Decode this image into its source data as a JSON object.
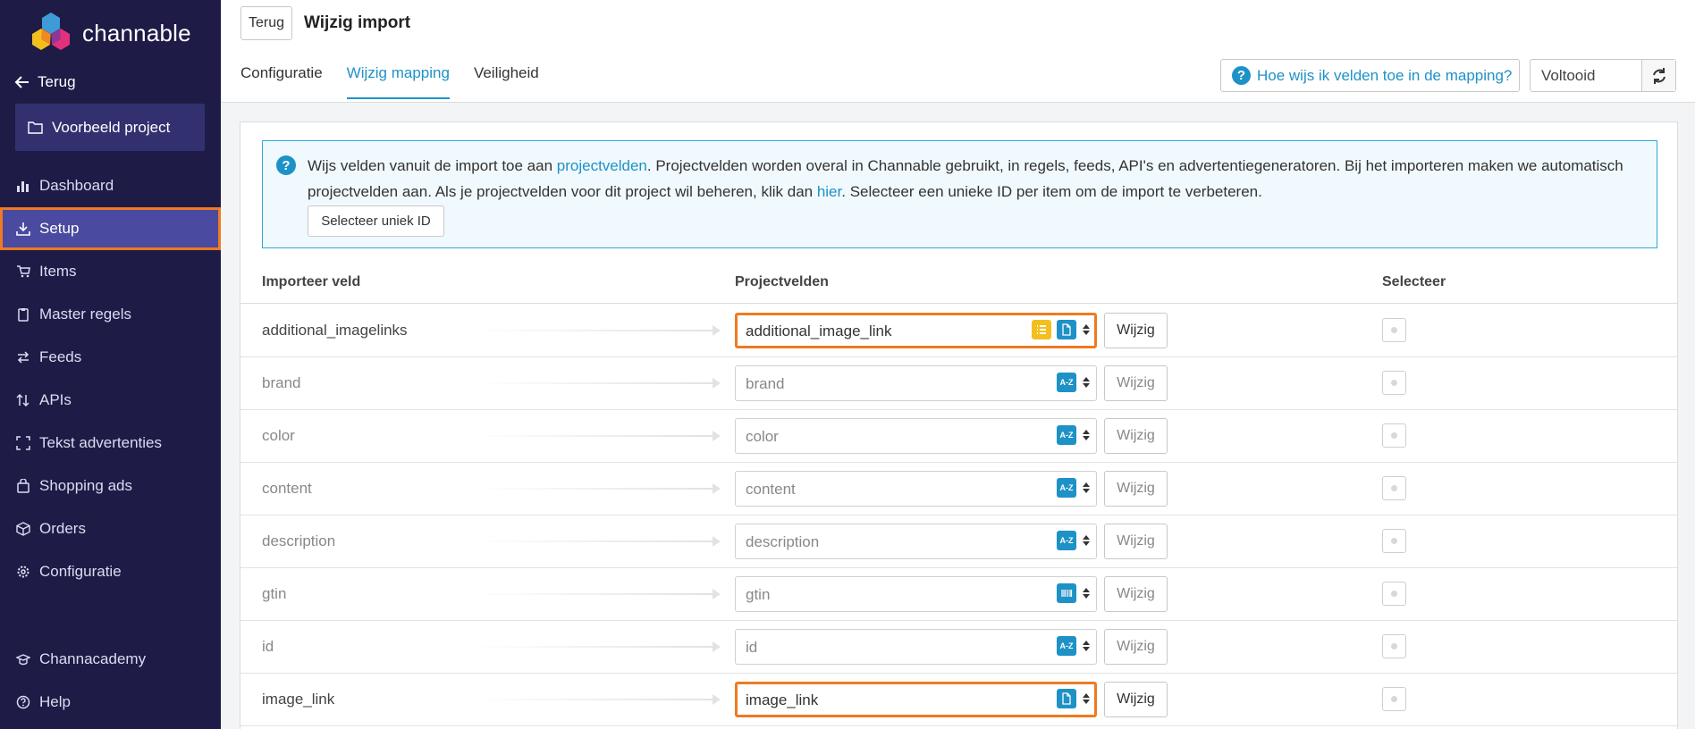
{
  "brand": {
    "name": "channable"
  },
  "sidebar": {
    "back_label": "Terug",
    "project_label": "Voorbeeld project",
    "items": [
      {
        "label": "Dashboard",
        "icon": "chart-bar-icon",
        "active": false
      },
      {
        "label": "Setup",
        "icon": "import-icon",
        "active": true
      },
      {
        "label": "Items",
        "icon": "cart-icon",
        "active": false
      },
      {
        "label": "Master regels",
        "icon": "clipboard-icon",
        "active": false
      },
      {
        "label": "Feeds",
        "icon": "arrows-icon",
        "active": false
      },
      {
        "label": "APIs",
        "icon": "sort-icon",
        "active": false
      },
      {
        "label": "Tekst advertenties",
        "icon": "expand-icon",
        "active": false
      },
      {
        "label": "Shopping ads",
        "icon": "bag-icon",
        "active": false
      },
      {
        "label": "Orders",
        "icon": "box-icon",
        "active": false
      },
      {
        "label": "Configuratie",
        "icon": "gear-icon",
        "active": false
      }
    ],
    "bottom_items": [
      {
        "label": "Channacademy",
        "icon": "graduation-cap-icon"
      },
      {
        "label": "Help",
        "icon": "question-circle-icon"
      }
    ]
  },
  "header": {
    "back_button": "Terug",
    "title": "Wijzig import",
    "tabs": [
      {
        "label": "Configuratie",
        "active": false
      },
      {
        "label": "Wijzig mapping",
        "active": true
      },
      {
        "label": "Veiligheid",
        "active": false
      }
    ],
    "help_button": "Hoe wijs ik velden toe in de mapping?",
    "status": "Voltooid"
  },
  "info": {
    "text_1": "Wijs velden vanuit de import toe aan ",
    "link_1": "projectvelden",
    "text_2": ". Projectvelden worden overal in Channable gebruikt, in regels, feeds, API's en advertentiegeneratoren. Bij het importeren maken we automatisch projectvelden aan. Als je projectvelden voor dit project wil beheren, klik dan ",
    "link_2": "hier",
    "text_3": ". Selecteer een unieke ID per item om de import te verbeteren.",
    "unique_id_button": "Selecteer uniek ID"
  },
  "table": {
    "columns": [
      "Importeer veld",
      "Projectvelden",
      "Selecteer"
    ],
    "edit_label": "Wijzig",
    "rows": [
      {
        "import_field": "additional_imagelinks",
        "project_field": "additional_image_link",
        "types": [
          "list",
          "file"
        ],
        "highlighted": true
      },
      {
        "import_field": "brand",
        "project_field": "brand",
        "types": [
          "text"
        ],
        "highlighted": false
      },
      {
        "import_field": "color",
        "project_field": "color",
        "types": [
          "text"
        ],
        "highlighted": false
      },
      {
        "import_field": "content",
        "project_field": "content",
        "types": [
          "text"
        ],
        "highlighted": false
      },
      {
        "import_field": "description",
        "project_field": "description",
        "types": [
          "text"
        ],
        "highlighted": false
      },
      {
        "import_field": "gtin",
        "project_field": "gtin",
        "types": [
          "barcode"
        ],
        "highlighted": false
      },
      {
        "import_field": "id",
        "project_field": "id",
        "types": [
          "text"
        ],
        "highlighted": false
      },
      {
        "import_field": "image_link",
        "project_field": "image_link",
        "types": [
          "file"
        ],
        "highlighted": true
      }
    ]
  },
  "colors": {
    "sidebar": "#1e1b47",
    "active_nav": "#4a4aa0",
    "accent": "#1e92c6",
    "highlight": "#ef7a22"
  }
}
